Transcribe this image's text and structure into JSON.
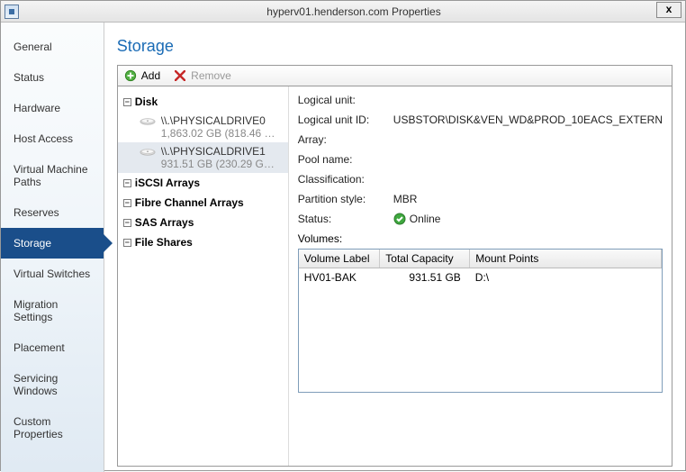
{
  "window": {
    "title": "hyperv01.henderson.com Properties",
    "close": "x"
  },
  "sidebar": {
    "items": [
      {
        "label": "General"
      },
      {
        "label": "Status"
      },
      {
        "label": "Hardware"
      },
      {
        "label": "Host Access"
      },
      {
        "label": "Virtual Machine Paths"
      },
      {
        "label": "Reserves"
      },
      {
        "label": "Storage"
      },
      {
        "label": "Virtual Switches"
      },
      {
        "label": "Migration Settings"
      },
      {
        "label": "Placement"
      },
      {
        "label": "Servicing Windows"
      },
      {
        "label": "Custom Properties"
      }
    ],
    "selected_index": 6
  },
  "page": {
    "title": "Storage",
    "toolbar": {
      "add": "Add",
      "remove": "Remove"
    },
    "tree": {
      "disk": {
        "label": "Disk",
        "drives": [
          {
            "name": "\\\\.\\PHYSICALDRIVE0",
            "size": "1,863.02 GB (818.46 G..."
          },
          {
            "name": "\\\\.\\PHYSICALDRIVE1",
            "size": "931.51 GB (230.29 GB..."
          }
        ],
        "selected_drive_index": 1
      },
      "iscsi": "iSCSI Arrays",
      "fibre": "Fibre Channel Arrays",
      "sas": "SAS Arrays",
      "shares": "File Shares"
    },
    "detail": {
      "labels": {
        "lu": "Logical unit:",
        "luid": "Logical unit ID:",
        "array": "Array:",
        "pool": "Pool name:",
        "class": "Classification:",
        "part": "Partition style:",
        "status": "Status:",
        "vols": "Volumes:"
      },
      "values": {
        "lu": "",
        "luid": "USBSTOR\\DISK&VEN_WD&PROD_10EACS_EXTERN",
        "array": "",
        "pool": "",
        "class": "",
        "part": "MBR",
        "status": "Online"
      },
      "vol_headers": {
        "c1": "Volume Label",
        "c2": "Total Capacity",
        "c3": "Mount Points"
      },
      "vol_rows": [
        {
          "label": "HV01-BAK",
          "capacity": "931.51 GB",
          "mount": "D:\\"
        }
      ]
    }
  }
}
